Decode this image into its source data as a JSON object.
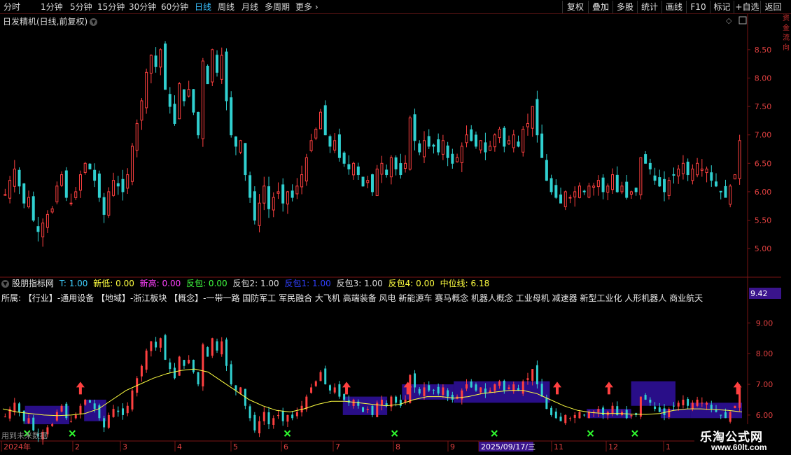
{
  "toolbar": {
    "periods": [
      "分时",
      "1分钟",
      "5分钟",
      "15分钟",
      "30分钟",
      "60分钟",
      "日线",
      "周线",
      "月线",
      "多周期",
      "更多"
    ],
    "active_period": "日线",
    "right_buttons": [
      "复权",
      "叠加",
      "多股",
      "统计",
      "画线",
      "F10",
      "标记",
      "+自选",
      "返回"
    ]
  },
  "chart_title": "日发精机(日线,前复权)",
  "main_axis": {
    "ticks": [
      "8.50",
      "8.00",
      "7.50",
      "7.00",
      "6.50",
      "6.00",
      "5.50",
      "5.00"
    ],
    "ylim": [
      4.62,
      8.88
    ]
  },
  "indicator": {
    "name": "股朋指标网",
    "items": [
      {
        "text": "T: 1.00",
        "color": "#3fd0ff"
      },
      {
        "text": "新低: 0.00",
        "color": "#ffff40"
      },
      {
        "text": "新高: 0.00",
        "color": "#ff40ff"
      },
      {
        "text": "反包: 0.00",
        "color": "#40ff40"
      },
      {
        "text": "反包2: 1.00",
        "color": "#dddddd"
      },
      {
        "text": "反包1: 1.00",
        "color": "#3040ff"
      },
      {
        "text": "反包3: 1.00",
        "color": "#dddddd"
      },
      {
        "text": "反包4: 0.00",
        "color": "#ffff40"
      },
      {
        "text": "中位线: 6.18",
        "color": "#ffff40"
      }
    ],
    "price_tag": "9.42",
    "axis_ticks": [
      "9.00",
      "8.00",
      "7.00",
      "6.00"
    ],
    "ylim": [
      5.2,
      9.6
    ]
  },
  "concept_row": "所属:    【行业】-通用设备 【地域】-浙江板块       【概念】-一带一路 国防军工 军民融合 大飞机 高端装备 风电 新能源车 赛马概念 机器人概念 工业母机 减速器 新型工业化 人形机器人 商业航天",
  "future_note": "用到未来数据",
  "time_axis": {
    "labels": [
      "2024年",
      "2",
      "3",
      "4",
      "5",
      "6",
      "7",
      "8",
      "9",
      "2025/09/17/三",
      "11",
      "12",
      "1"
    ]
  },
  "watermark": {
    "line1": "乐淘公式网",
    "line2": "www.60lt.com"
  },
  "side_strip": "资金流向",
  "colors": {
    "up": "#ff4040",
    "down": "#30d0d0",
    "ma": "#ffff40",
    "box": "#3010a0",
    "signal_x": "#30ff30"
  },
  "chart_data": {
    "type": "candlestick",
    "main_ylim": [
      4.62,
      8.88
    ],
    "indicator_ylim": [
      5.2,
      9.6
    ],
    "close_series": [
      5.95,
      6.2,
      6.4,
      6.1,
      5.8,
      5.9,
      5.5,
      5.3,
      5.45,
      5.6,
      5.7,
      6.1,
      6.3,
      5.9,
      5.8,
      6.0,
      6.3,
      6.5,
      6.4,
      6.2,
      5.9,
      5.6,
      6.0,
      6.2,
      6.1,
      6.0,
      6.3,
      6.8,
      7.2,
      7.6,
      8.1,
      8.4,
      8.2,
      8.5,
      7.8,
      7.5,
      7.2,
      7.9,
      7.6,
      7.8,
      7.4,
      7.0,
      8.3,
      7.9,
      8.5,
      8.1,
      8.4,
      7.6,
      7.0,
      6.8,
      6.9,
      6.3,
      5.9,
      5.5,
      5.8,
      6.1,
      5.7,
      5.9,
      6.0,
      5.8,
      6.0,
      5.9,
      6.1,
      6.3,
      6.6,
      6.9,
      7.1,
      7.4,
      7.0,
      6.8,
      6.9,
      6.6,
      6.5,
      6.4,
      6.5,
      6.3,
      6.1,
      6.2,
      6.0,
      6.4,
      6.5,
      6.3,
      6.6,
      6.4,
      6.3,
      6.5,
      7.3,
      6.9,
      6.7,
      6.9,
      6.8,
      6.8,
      6.7,
      6.9,
      6.6,
      6.5,
      6.6,
      6.8,
      7.0,
      6.9,
      6.8,
      6.9,
      6.7,
      6.8,
      7.0,
      7.1,
      6.8,
      6.9,
      7.0,
      6.8,
      7.1,
      7.2,
      7.5,
      7.0,
      6.6,
      6.2,
      6.0,
      5.9,
      5.8,
      6.0,
      5.9,
      6.0,
      6.1,
      6.0,
      6.1,
      6.1,
      6.2,
      6.0,
      6.1,
      6.3,
      6.0,
      6.1,
      5.9,
      6.0,
      6.0,
      6.6,
      6.5,
      6.4,
      6.2,
      6.1,
      6.0,
      6.2,
      6.3,
      6.4,
      6.5,
      6.3,
      6.4,
      6.5,
      6.4,
      6.4,
      6.2,
      6.1,
      6.0,
      5.9,
      6.1,
      6.3,
      6.9
    ],
    "ma_series": [
      6.2,
      6.1,
      6.05,
      6.0,
      5.98,
      6.0,
      6.05,
      6.2,
      6.5,
      6.8,
      7.0,
      7.2,
      7.35,
      7.45,
      7.5,
      7.4,
      7.1,
      6.8,
      6.5,
      6.3,
      6.15,
      6.1,
      6.2,
      6.35,
      6.45,
      6.45,
      6.4,
      6.35,
      6.3,
      6.35,
      6.5,
      6.6,
      6.6,
      6.55,
      6.6,
      6.7,
      6.75,
      6.8,
      6.8,
      6.7,
      6.5,
      6.3,
      6.15,
      6.08,
      6.05,
      6.05,
      6.03,
      6.02,
      6.05,
      6.15,
      6.2,
      6.2,
      6.18,
      6.15,
      6.1
    ],
    "x_labels": [
      "2024年",
      "2",
      "3",
      "4",
      "5",
      "6",
      "7",
      "8",
      "9",
      "2025/09/17/三",
      "11",
      "12",
      "1"
    ]
  }
}
